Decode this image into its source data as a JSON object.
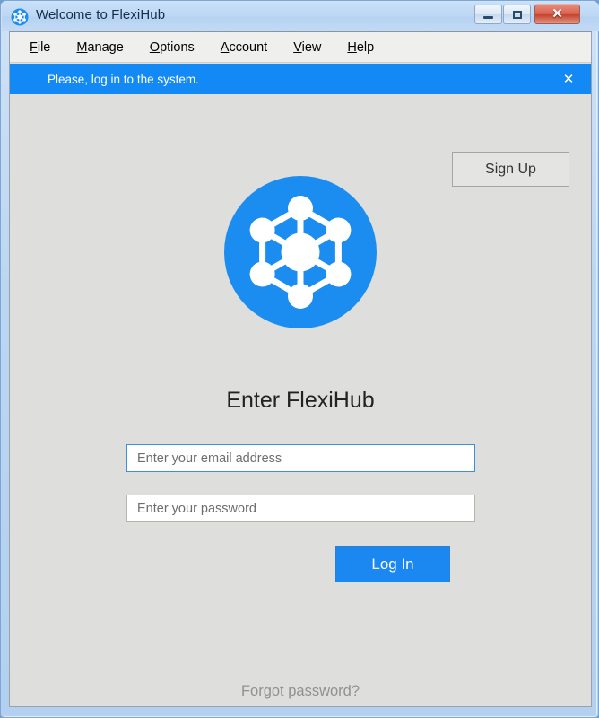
{
  "window": {
    "title": "Welcome to FlexiHub",
    "app_icon": "flexihub-network-icon",
    "controls": {
      "minimize": "minimize-icon",
      "maximize": "maximize-icon",
      "close": "✕"
    }
  },
  "menu": {
    "items": [
      {
        "accel": "F",
        "rest": "ile"
      },
      {
        "accel": "M",
        "rest": "anage"
      },
      {
        "accel": "O",
        "rest": "ptions"
      },
      {
        "accel": "A",
        "rest": "ccount"
      },
      {
        "accel": "V",
        "rest": "iew"
      },
      {
        "accel": "H",
        "rest": "elp"
      }
    ]
  },
  "notification": {
    "message": "Please, log in to the system.",
    "close_label": "✕",
    "background_color": "#1389f5",
    "text_color": "#ffffff"
  },
  "main": {
    "signup_label": "Sign Up",
    "heading": "Enter FlexiHub",
    "email_placeholder": "Enter your email address",
    "email_value": "",
    "password_placeholder": "Enter your password",
    "password_value": "",
    "login_label": "Log In",
    "forgot_password_label": "Forgot password?"
  },
  "logo": {
    "name": "flexihub-network-logo",
    "circle_color": "#1b8cf0",
    "node_color": "#ffffff"
  },
  "colors": {
    "accent_blue": "#1389f5",
    "button_blue": "#1a88f0",
    "window_background": "#dededc",
    "menu_background": "#efefed",
    "focus_border": "#3b8fdd",
    "muted_text": "#919191"
  }
}
